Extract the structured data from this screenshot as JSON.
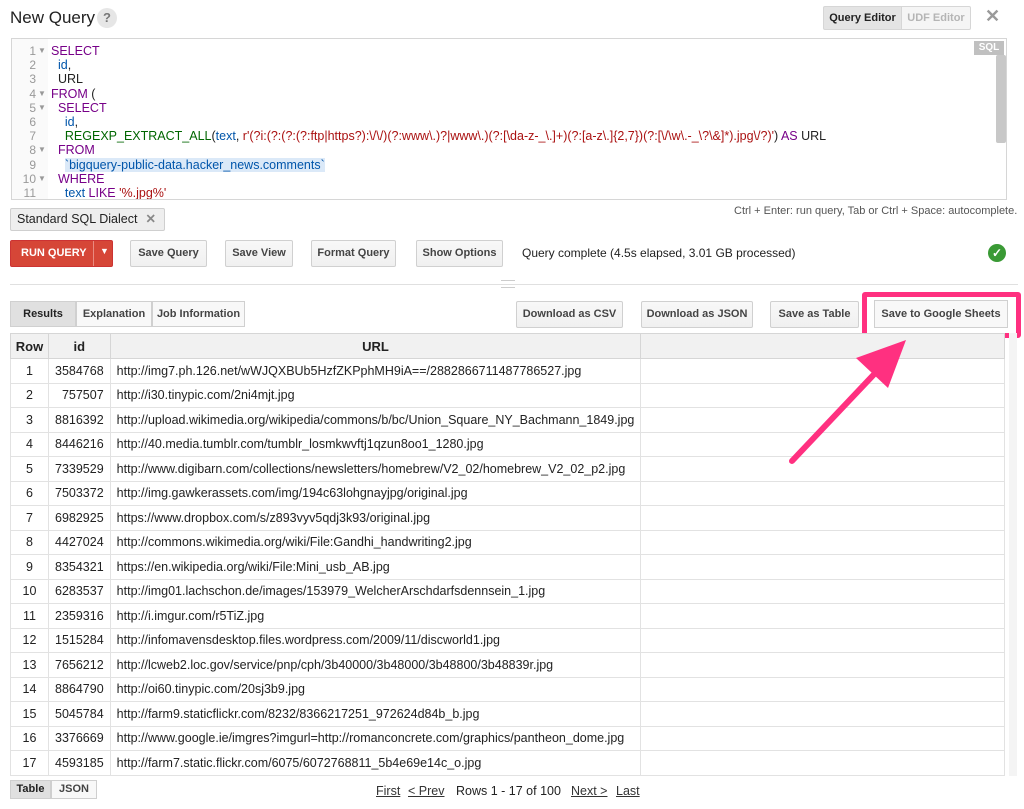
{
  "header": {
    "title": "New Query",
    "help_label": "?",
    "query_editor_label": "Query Editor",
    "udf_editor_label": "UDF Editor",
    "close_label": "✕"
  },
  "editor": {
    "badge": "SQL",
    "lines": [
      {
        "n": "1",
        "text": "SELECT"
      },
      {
        "n": "2",
        "text": "  id,"
      },
      {
        "n": "3",
        "text": "  URL"
      },
      {
        "n": "4",
        "text": "FROM ("
      },
      {
        "n": "5",
        "text": "  SELECT"
      },
      {
        "n": "6",
        "text": "    id,"
      },
      {
        "n": "7",
        "text": "    REGEXP_EXTRACT_ALL(text, r'(?i:(?:(?:(?:ftp|https?):\\/\\/)(?:www\\.)?|www\\.)(?:[\\da-z-_\\.]+)(?:[a-z\\.]{2,7})(?:[\\/\\w\\.-_\\?\\&]*).jpg\\/?)') AS URL"
      },
      {
        "n": "8",
        "text": "  FROM"
      },
      {
        "n": "9",
        "text": "    `bigquery-public-data.hacker_news.comments`"
      },
      {
        "n": "10",
        "text": "  WHERE"
      },
      {
        "n": "11",
        "text": "    text LIKE '%.jpg%'"
      }
    ]
  },
  "dialect": {
    "label": "Standard SQL Dialect",
    "remove": "✕"
  },
  "hint": "Ctrl + Enter: run query, Tab or Ctrl + Space: autocomplete.",
  "toolbar": {
    "run_label": "RUN QUERY",
    "run_caret": "▼",
    "save_query": "Save Query",
    "save_view": "Save View",
    "format_query": "Format Query",
    "show_options": "Show Options",
    "status": "Query complete (4.5s elapsed, 3.01 GB processed)",
    "status_icon": "✓"
  },
  "results": {
    "tabs": [
      "Results",
      "Explanation",
      "Job Information"
    ],
    "download_csv": "Download as CSV",
    "download_json": "Download as JSON",
    "save_table": "Save as Table",
    "save_sheets": "Save to Google Sheets",
    "columns": [
      "Row",
      "id",
      "URL",
      ""
    ],
    "rows": [
      [
        "1",
        "3584768",
        "http://img7.ph.126.net/wWJQXBUb5HzfZKPphMH9iA==/2882866711487786527.jpg"
      ],
      [
        "2",
        "757507",
        "http://i30.tinypic.com/2ni4mjt.jpg"
      ],
      [
        "3",
        "8816392",
        "http://upload.wikimedia.org/wikipedia/commons/b/bc/Union_Square_NY_Bachmann_1849.jpg"
      ],
      [
        "4",
        "8446216",
        "http://40.media.tumblr.com/tumblr_losmkwvftj1qzun8oo1_1280.jpg"
      ],
      [
        "5",
        "7339529",
        "http://www.digibarn.com/collections/newsletters/homebrew/V2_02/homebrew_V2_02_p2.jpg"
      ],
      [
        "6",
        "7503372",
        "http://img.gawkerassets.com/img/194c63lohgnayjpg/original.jpg"
      ],
      [
        "7",
        "6982925",
        "https://www.dropbox.com/s/z893vyv5qdj3k93/original.jpg"
      ],
      [
        "8",
        "4427024",
        "http://commons.wikimedia.org/wiki/File:Gandhi_handwriting2.jpg"
      ],
      [
        "9",
        "8354321",
        "https://en.wikipedia.org/wiki/File:Mini_usb_AB.jpg"
      ],
      [
        "10",
        "6283537",
        "http://img01.lachschon.de/images/153979_WelcherArschdarfsdennsein_1.jpg"
      ],
      [
        "11",
        "2359316",
        "http://i.imgur.com/r5TiZ.jpg"
      ],
      [
        "12",
        "1515284",
        "http://infomavensdesktop.files.wordpress.com/2009/11/discworld1.jpg"
      ],
      [
        "13",
        "7656212",
        "http://lcweb2.loc.gov/service/pnp/cph/3b40000/3b48000/3b48800/3b48839r.jpg"
      ],
      [
        "14",
        "8864790",
        "http://oi60.tinypic.com/20sj3b9.jpg"
      ],
      [
        "15",
        "5045784",
        "http://farm9.staticflickr.com/8232/8366217251_972624d84b_b.jpg"
      ],
      [
        "16",
        "3376669",
        "http://www.google.ie/imgres?imgurl=http://romanconcrete.com/graphics/pantheon_dome.jpg"
      ],
      [
        "17",
        "4593185",
        "http://farm7.static.flickr.com/6075/6072768811_5b4e69e14c_o.jpg"
      ]
    ]
  },
  "footer": {
    "view_tabs": [
      "Table",
      "JSON"
    ],
    "first": "First",
    "prev": "< Prev",
    "range": "Rows 1 - 17 of 100",
    "next": "Next >",
    "last": "Last"
  },
  "colors": {
    "run_button": "#d64637",
    "highlight": "#ff3080",
    "success": "#3a9a35"
  }
}
